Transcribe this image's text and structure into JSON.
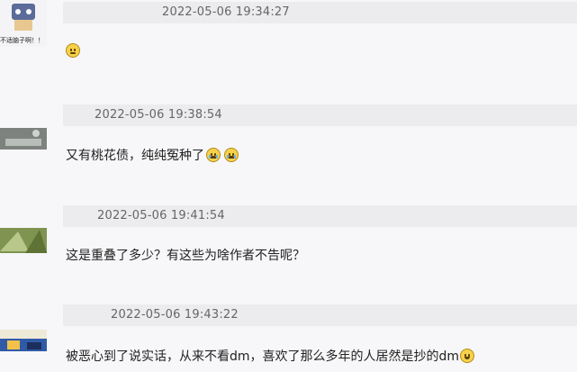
{
  "messages": [
    {
      "timestamp": "2022-05-06 19:34:27",
      "avatar_label": "不适脑子啊！！",
      "text": "",
      "emojis": [
        "neutral-face"
      ]
    },
    {
      "timestamp": "2022-05-06 19:38:54",
      "avatar_label": "",
      "text": "又有桃花债，纯纯冤种了",
      "emojis": [
        "crying-face",
        "crying-face"
      ]
    },
    {
      "timestamp": "2022-05-06 19:41:54",
      "avatar_label": "",
      "text": "这是重叠了多少？有这些为啥作者不告呢？",
      "emojis": []
    },
    {
      "timestamp": "2022-05-06 19:43:22",
      "avatar_label": "",
      "text": "被恶心到了说实话，从来不看dm，喜欢了那么多年的人居然是抄的dm",
      "emojis": [
        "smiling-face"
      ]
    }
  ],
  "colors": {
    "timestamp_bar": "#ececee",
    "message_bg": "#f6f6f8",
    "timestamp_text": "#666666",
    "message_text": "#222222",
    "emoji_yellow": "#f6d24a"
  }
}
